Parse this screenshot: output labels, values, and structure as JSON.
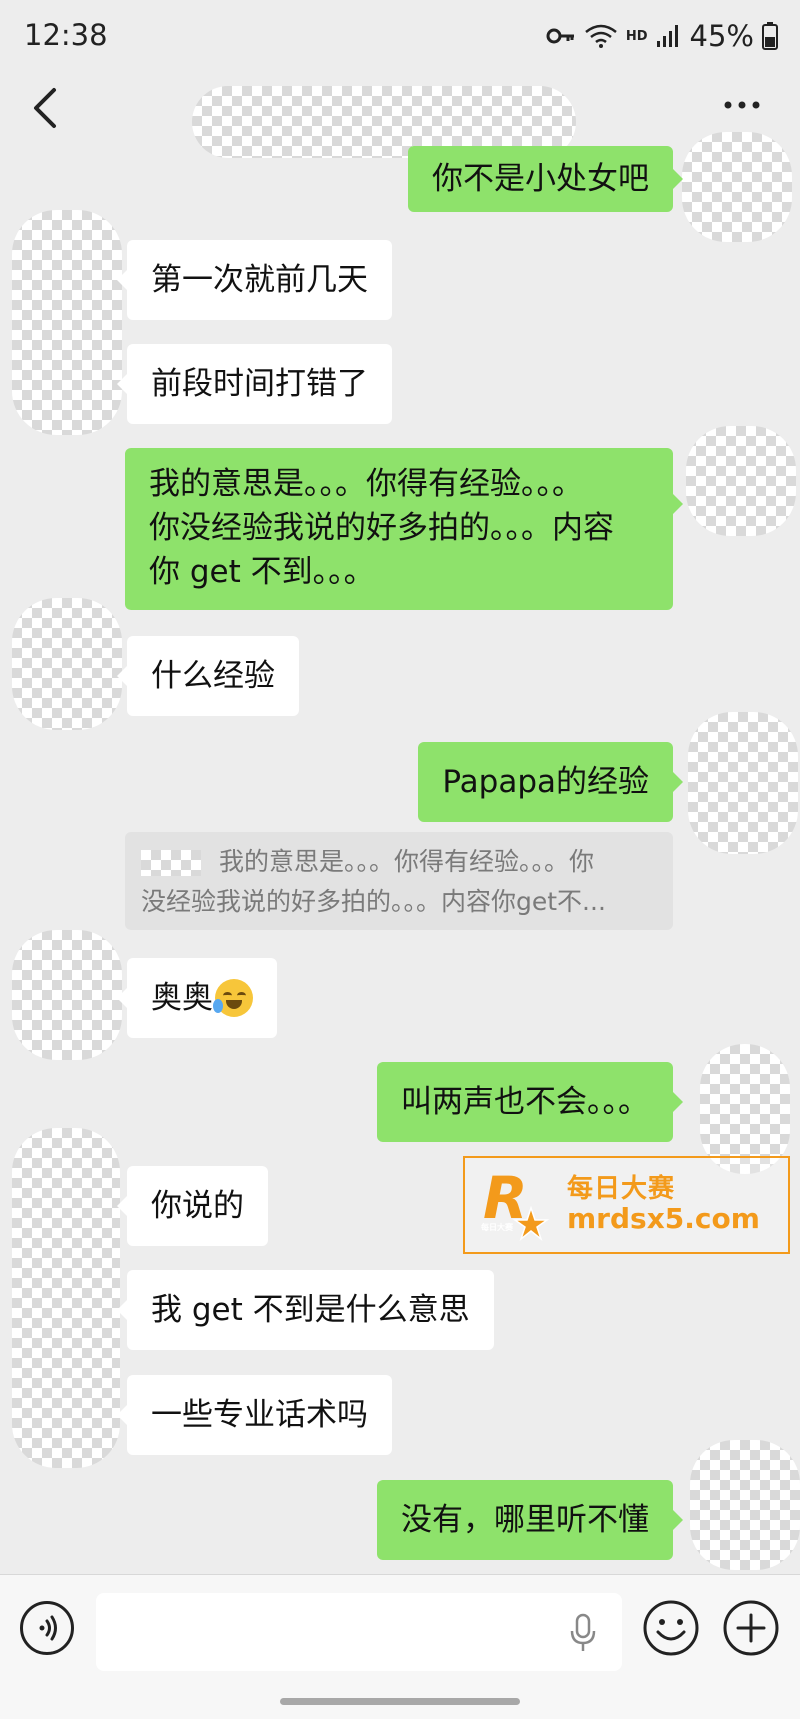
{
  "status_bar": {
    "time": "12:38",
    "hd_label": "HD",
    "battery": "45%",
    "icons": [
      "key-icon",
      "wifi-icon",
      "signal-icon",
      "battery-icon"
    ]
  },
  "nav": {
    "back_icon": "chevron-left-icon",
    "more_icon": "more-dots-icon"
  },
  "messages": [
    {
      "side": "sent",
      "text": "你不是小处女吧"
    },
    {
      "side": "received",
      "text": "第一次就前几天"
    },
    {
      "side": "received",
      "text": "前段时间打错了"
    },
    {
      "side": "sent",
      "lines": [
        "我的意思是。。。你得有经验。。。",
        "你没经验我说的好多拍的。。。内容",
        "你 get 不到。。。"
      ]
    },
    {
      "side": "received",
      "text": "什么经验"
    },
    {
      "side": "sent",
      "text": "Papapa的经验"
    },
    {
      "side": "quote",
      "lines": [
        "我的意思是。。。你得有经验。。。你",
        "没经验我说的好多拍的。。。内容你get不..."
      ]
    },
    {
      "side": "received",
      "text": "奥奥",
      "emoji": "laughing-tears-emoji"
    },
    {
      "side": "sent",
      "text": "叫两声也不会。。。"
    },
    {
      "side": "received",
      "text": "你说的"
    },
    {
      "side": "received",
      "text": "我 get 不到是什么意思"
    },
    {
      "side": "received",
      "text": "一些专业话术吗"
    },
    {
      "side": "sent",
      "text": "没有，哪里听不懂"
    }
  ],
  "watermark": {
    "title": "每日大赛",
    "url": "mrdsx5.com",
    "logo_letter": "R",
    "small_text": "每日大赛",
    "color": "#f39a1b"
  },
  "input_bar": {
    "value": "",
    "icons": [
      "voice-icon",
      "mic-icon",
      "emoji-icon",
      "plus-icon"
    ]
  },
  "colors": {
    "background": "#ededed",
    "sent_bubble": "#8ee26b",
    "received_bubble": "#ffffff"
  }
}
